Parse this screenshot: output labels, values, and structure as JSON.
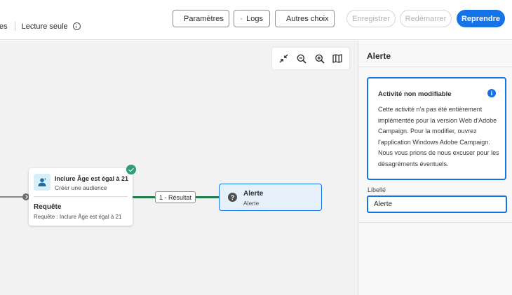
{
  "breadcrumb": {
    "fragment": "es",
    "mode": "Lecture seule"
  },
  "toolbar": {
    "parametres": "Paramètres",
    "logs": "Logs",
    "autres_choix": "Autres choix",
    "enregistrer": "Enregistrer",
    "redemarrer": "Redémarrer",
    "reprendre": "Reprendre"
  },
  "canvas": {
    "zoom_tools": [
      "fit-icon",
      "zoom-out-icon",
      "zoom-in-icon",
      "map-icon"
    ],
    "node_audience": {
      "title": "Inclure Âge est égal à 21",
      "subtitle": "Créer une audience",
      "section_title": "Requête",
      "section_value": "Requête : Inclure Âge est égal à 21",
      "status": "success"
    },
    "transition_label": "1 - Résultat",
    "node_alert": {
      "title": "Alerte",
      "subtitle": "Alerte"
    }
  },
  "panel": {
    "title": "Alerte",
    "notice": {
      "title": "Activité non modifiable",
      "body": "Cette activité n'a pas été entièrement implémentée pour la version Web d'Adobe Campaign. Pour la modifier, ouvrez l'application Windows Adobe Campaign. Nous vous prions de nous excuser pour les désagréments éventuels."
    },
    "label_field": {
      "label": "Libellé",
      "value": "Alerte"
    }
  },
  "colors": {
    "accent": "#1473e6",
    "success": "#2d9d78",
    "edge_active": "#1e7b4a"
  }
}
